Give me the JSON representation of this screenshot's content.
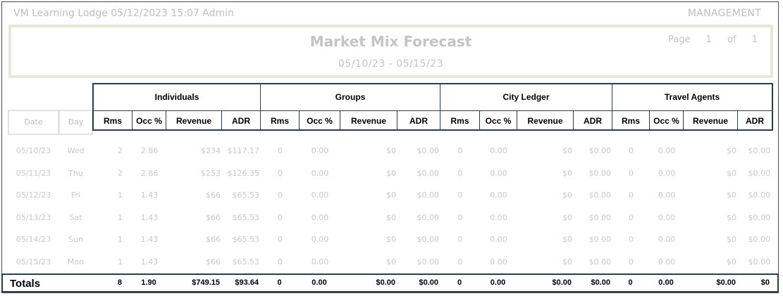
{
  "header": {
    "left": "VM Learning Lodge 05/12/2023 15:07 Admin",
    "right": "MANAGEMENT"
  },
  "report": {
    "title": "Market Mix Forecast",
    "range": "05/10/23 - 05/15/23",
    "page_label": "Page",
    "page_num": "1",
    "of_label": "of",
    "page_total": "1"
  },
  "groups": [
    "Individuals",
    "Groups",
    "City Ledger",
    "Travel Agents"
  ],
  "subcols": [
    "Rms",
    "Occ %",
    "Revenue",
    "ADR"
  ],
  "date_label": "Date",
  "day_label": "Day",
  "rows": [
    [
      "05/10/23",
      "Wed",
      "2",
      "2.86",
      "$234",
      "$117.17",
      "0",
      "0.00",
      "$0",
      "$0.00",
      "0",
      "0.00",
      "$0",
      "$0.00",
      "0",
      "0.00",
      "$0",
      "$0.00"
    ],
    [
      "05/11/23",
      "Thu",
      "2",
      "2.86",
      "$253",
      "$126.35",
      "0",
      "0.00",
      "$0",
      "$0.00",
      "0",
      "0.00",
      "$0",
      "$0.00",
      "0",
      "0.00",
      "$0",
      "$0.00"
    ],
    [
      "05/12/23",
      "Fri",
      "1",
      "1.43",
      "$66",
      "$65.53",
      "0",
      "0.00",
      "$0",
      "$0.00",
      "0",
      "0.00",
      "$0",
      "$0.00",
      "0",
      "0.00",
      "$0",
      "$0.00"
    ],
    [
      "05/13/23",
      "Sat",
      "1",
      "1.43",
      "$66",
      "$65.53",
      "0",
      "0.00",
      "$0",
      "$0.00",
      "0",
      "0.00",
      "$0",
      "$0.00",
      "0",
      "0.00",
      "$0",
      "$0.00"
    ],
    [
      "05/14/23",
      "Sun",
      "1",
      "1.43",
      "$66",
      "$65.53",
      "0",
      "0.00",
      "$0",
      "$0.00",
      "0",
      "0.00",
      "$0",
      "$0.00",
      "0",
      "0.00",
      "$0",
      "$0.00"
    ],
    [
      "05/15/23",
      "Mon",
      "1",
      "1.43",
      "$66",
      "$65.53",
      "0",
      "0.00",
      "$0",
      "$0.00",
      "0",
      "0.00",
      "$0",
      "$0.00",
      "0",
      "0.00",
      "$0",
      "$0.00"
    ]
  ],
  "totals": {
    "label": "Totals",
    "values": [
      "8",
      "1.90",
      "$749.15",
      "$93.64",
      "0",
      "0.00",
      "$0.00",
      "$0.00",
      "0",
      "0.00",
      "$0.00",
      "$0.00",
      "0",
      "0.00",
      "$0.00",
      "$0"
    ]
  }
}
